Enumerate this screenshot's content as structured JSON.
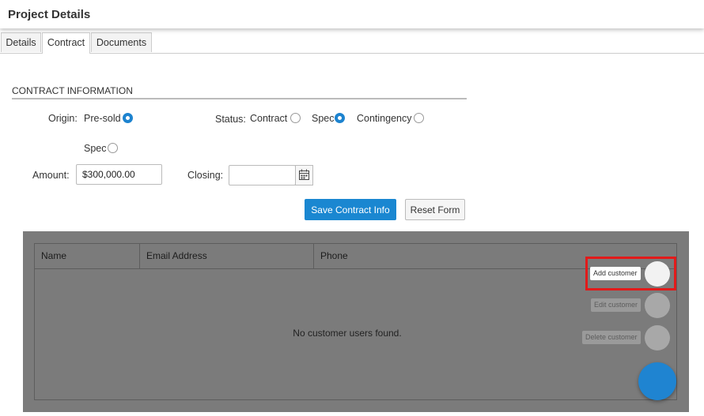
{
  "header": {
    "title": "Project Details"
  },
  "tabs": [
    {
      "label": "Details"
    },
    {
      "label": "Contract"
    },
    {
      "label": "Documents"
    }
  ],
  "contract": {
    "section_title": "CONTRACT INFORMATION",
    "origin_label": "Origin:",
    "origin_options": [
      "Pre-sold",
      "Spec"
    ],
    "origin_selected": "Pre-sold",
    "status_label": "Status:",
    "status_options": [
      "Contract",
      "Spec",
      "Contingency"
    ],
    "status_selected": "Spec",
    "amount_label": "Amount:",
    "amount_value": "$300,000.00",
    "closing_label": "Closing:",
    "closing_value": "",
    "save_label": "Save Contract Info",
    "reset_label": "Reset Form"
  },
  "customers_grid": {
    "columns": [
      "Name",
      "Email Address",
      "Phone"
    ],
    "empty_message": "No customer users found."
  },
  "fab_menu": {
    "actions": [
      {
        "label": "Add customer",
        "state": "active"
      },
      {
        "label": "Edit customer",
        "state": "disabled"
      },
      {
        "label": "Delete customer",
        "state": "disabled"
      }
    ]
  },
  "colors": {
    "accent": "#1a87d1",
    "highlight": "#e21a1a",
    "overlay": "#7b7b7b"
  }
}
